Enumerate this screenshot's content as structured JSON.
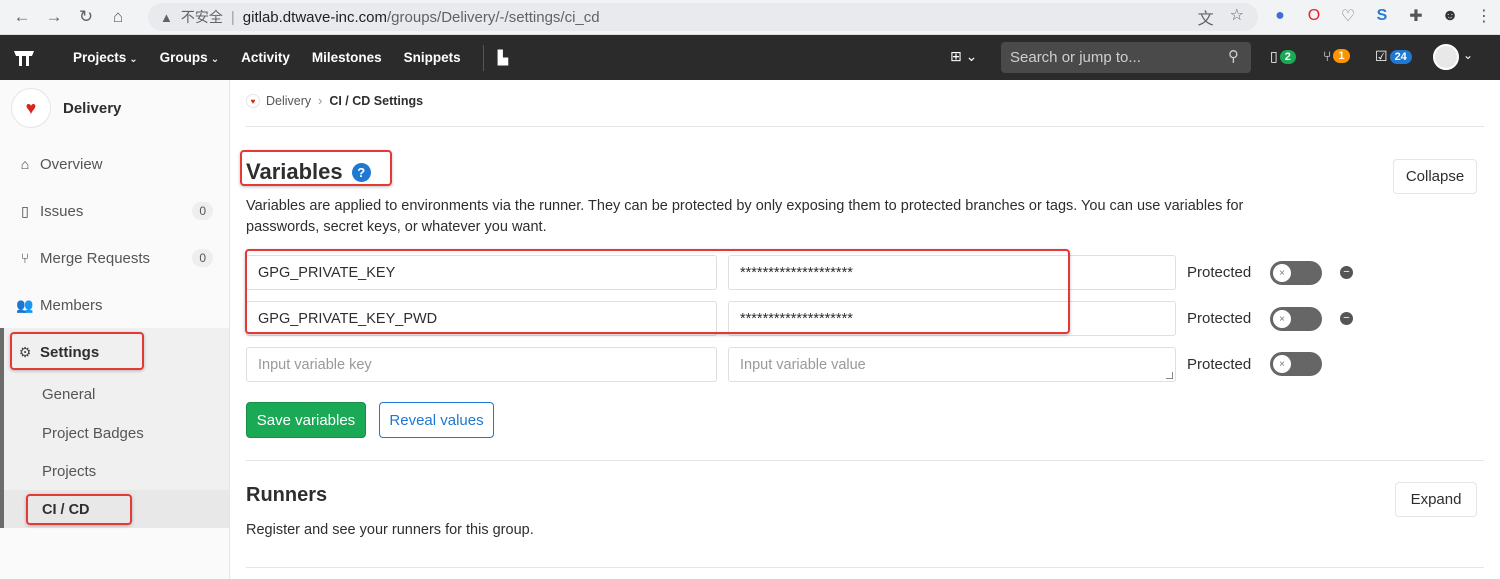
{
  "browser": {
    "warning_label": "不安全",
    "url_host": "gitlab.dtwave-inc.com",
    "url_path": "/groups/Delivery/-/settings/ci_cd"
  },
  "topnav": {
    "items": [
      "Projects",
      "Groups",
      "Activity",
      "Milestones",
      "Snippets"
    ],
    "search_placeholder": "Search or jump to...",
    "issues_count": "2",
    "mr_count": "1",
    "todos_count": "24"
  },
  "sidebar": {
    "group_name": "Delivery",
    "items": [
      {
        "label": "Overview"
      },
      {
        "label": "Issues",
        "count": "0"
      },
      {
        "label": "Merge Requests",
        "count": "0"
      },
      {
        "label": "Members"
      },
      {
        "label": "Settings"
      }
    ],
    "sub_items": [
      "General",
      "Project Badges",
      "Projects",
      "CI / CD"
    ]
  },
  "breadcrumb": {
    "group": "Delivery",
    "current": "CI / CD Settings"
  },
  "variables": {
    "title": "Variables",
    "collapse_label": "Collapse",
    "description": "Variables are applied to environments via the runner. They can be protected by only exposing them to protected branches or tags. You can use variables for passwords, secret keys, or whatever you want.",
    "rows": [
      {
        "key": "GPG_PRIVATE_KEY",
        "value": "********************",
        "protected_label": "Protected"
      },
      {
        "key": "GPG_PRIVATE_KEY_PWD",
        "value": "********************",
        "protected_label": "Protected"
      }
    ],
    "new_row": {
      "key_placeholder": "Input variable key",
      "value_placeholder": "Input variable value",
      "protected_label": "Protected"
    },
    "save_label": "Save variables",
    "reveal_label": "Reveal values"
  },
  "runners": {
    "title": "Runners",
    "expand_label": "Expand",
    "description": "Register and see your runners for this group."
  },
  "colors": {
    "navbar": "#2b2b2b",
    "primary_green": "#1aaa55",
    "link_blue": "#1f78d1",
    "annotation_red": "#e53935"
  }
}
